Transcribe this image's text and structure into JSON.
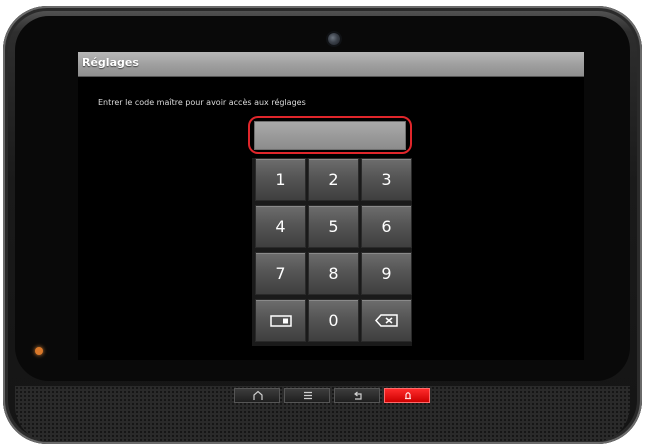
{
  "screen": {
    "title": "Réglages",
    "instruction": "Entrer le code maître pour avoir accès aux réglages",
    "code_value": ""
  },
  "keypad": {
    "keys": [
      "1",
      "2",
      "3",
      "4",
      "5",
      "6",
      "7",
      "8",
      "9",
      "0"
    ],
    "left_special_icon": "keyboard-icon",
    "right_special_icon": "backspace-icon"
  },
  "hardware_buttons": {
    "home_icon": "home-icon",
    "menu_icon": "menu-icon",
    "back_icon": "back-icon",
    "alert_icon": "bell-icon"
  },
  "colors": {
    "highlight": "#e0262b",
    "alert_button": "#e60000",
    "led": "#d9782a"
  }
}
